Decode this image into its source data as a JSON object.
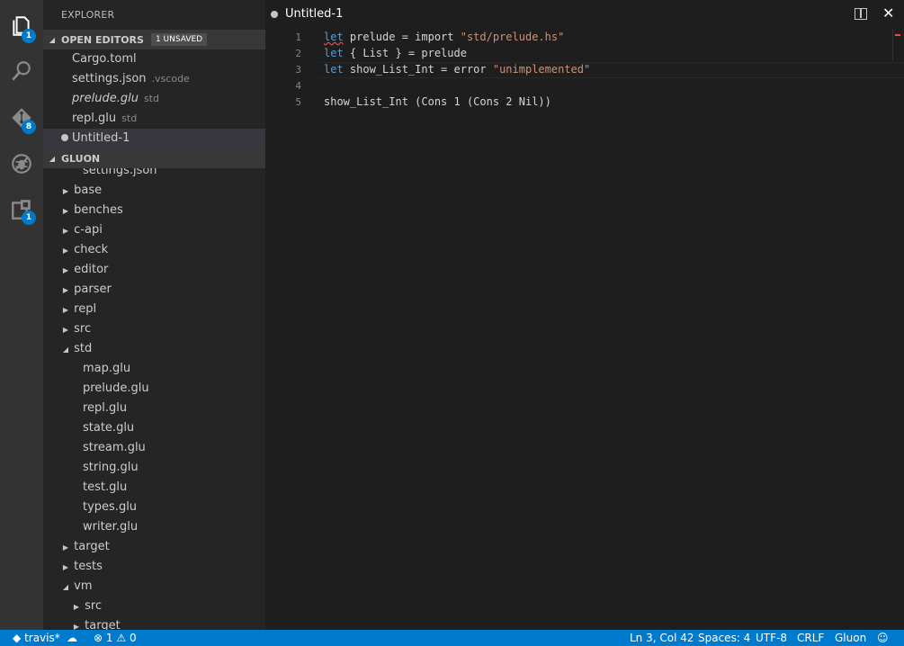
{
  "activity": {
    "explorer_badge": "1",
    "git_badge": "8",
    "extensions_badge": "1"
  },
  "sidebar": {
    "title": "EXPLORER",
    "open_editors": {
      "header": "OPEN EDITORS",
      "unsaved": "1 UNSAVED",
      "items": [
        {
          "name": "Cargo.toml",
          "dir": ""
        },
        {
          "name": "settings.json",
          "dir": ".vscode"
        },
        {
          "name": "prelude.glu",
          "dir": "std"
        },
        {
          "name": "repl.glu",
          "dir": "std"
        },
        {
          "name": "Untitled-1",
          "dir": ""
        }
      ]
    },
    "project": {
      "header": "GLUON",
      "items": [
        {
          "name": "settings.json"
        },
        {
          "name": "base"
        },
        {
          "name": "benches"
        },
        {
          "name": "c-api"
        },
        {
          "name": "check"
        },
        {
          "name": "editor"
        },
        {
          "name": "parser"
        },
        {
          "name": "repl"
        },
        {
          "name": "src"
        },
        {
          "name": "std"
        },
        {
          "name": "map.glu"
        },
        {
          "name": "prelude.glu"
        },
        {
          "name": "repl.glu"
        },
        {
          "name": "state.glu"
        },
        {
          "name": "stream.glu"
        },
        {
          "name": "string.glu"
        },
        {
          "name": "test.glu"
        },
        {
          "name": "types.glu"
        },
        {
          "name": "writer.glu"
        },
        {
          "name": "target"
        },
        {
          "name": "tests"
        },
        {
          "name": "vm"
        },
        {
          "name": "src"
        },
        {
          "name": "target"
        }
      ]
    }
  },
  "tab": {
    "title": "Untitled-1"
  },
  "editor": {
    "line_numbers": [
      "1",
      "2",
      "3",
      "4",
      "5"
    ],
    "lines": [
      {
        "kw": "let",
        "a": " prelude = import ",
        "s": "\"std/prelude.hs\"",
        "b": ""
      },
      {
        "kw": "let",
        "a": " { List } = prelude",
        "s": "",
        "b": ""
      },
      {
        "kw": "let",
        "a": " show_List_Int = error ",
        "s": "\"unimplemented\"",
        "b": ""
      },
      {
        "kw": "",
        "a": "",
        "s": "",
        "b": ""
      },
      {
        "kw": "",
        "a": "show_List_Int (Cons 1 (Cons 2 Nil))",
        "s": "",
        "b": ""
      }
    ]
  },
  "status": {
    "branch": "travis*",
    "errors": "1",
    "warnings": "0",
    "position": "Ln 3, Col 42",
    "spaces": "Spaces: 4",
    "encoding": "UTF-8",
    "eol": "CRLF",
    "language": "Gluon",
    "colors": {
      "bar": "#007acc"
    }
  }
}
